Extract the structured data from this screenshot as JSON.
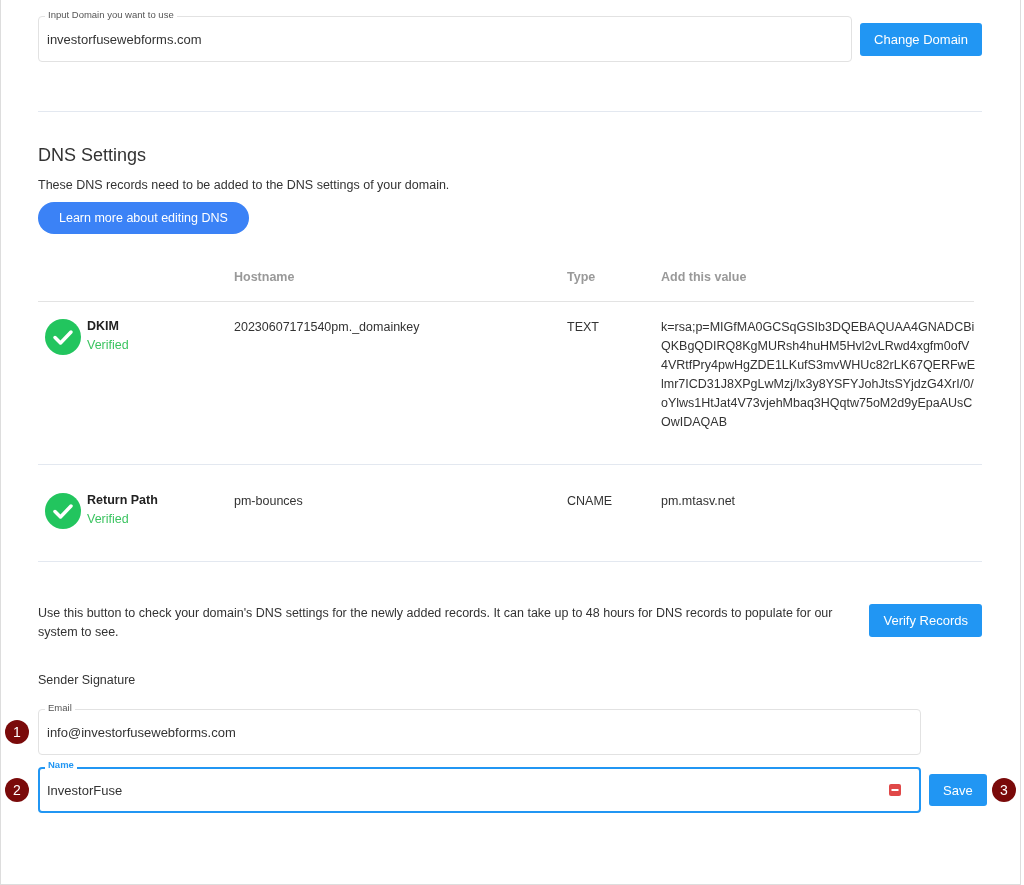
{
  "domain_field": {
    "label": "Input Domain you want to use",
    "value": "investorfusewebforms.com"
  },
  "change_domain_button": "Change Domain",
  "dns": {
    "title": "DNS Settings",
    "description": "These DNS records need to be added to the DNS settings of your domain.",
    "learn_more_button": "Learn more about editing DNS"
  },
  "table": {
    "columns": [
      "Hostname",
      "Type",
      "Add this value"
    ],
    "rows": [
      {
        "name": "DKIM",
        "status": "Verified",
        "verified": true,
        "hostname": "20230607171540pm._domainkey",
        "type": "TEXT",
        "value": "k=rsa;p=MIGfMA0GCSqGSIb3DQEBAQUAA4GNADCBiQKBgQDIRQ8KgMURsh4huHM5Hvl2vLRwd4xgfm0ofV4VRtfPry4pwHgZDE1LKufS3mvWHUc82rLK67QERFwElmr7ICD31J8XPgLwMzj/lx3y8YSFYJohJtsSYjdzG4XrI/0/oYlws1HtJat4V73vjehMbaq3HQqtw75oM2d9yEpaAUsCOwIDAQAB"
      },
      {
        "name": "Return Path",
        "status": "Verified",
        "verified": true,
        "hostname": "pm-bounces",
        "type": "CNAME",
        "value": "pm.mtasv.net"
      }
    ]
  },
  "verify": {
    "description": "Use this button to check your domain's DNS settings for the newly added records. It can take up to 48 hours for DNS records to populate for our system to see.",
    "button": "Verify Records"
  },
  "sender_signature": {
    "title": "Sender Signature",
    "fields": [
      {
        "label": "Email",
        "value": "info@investorfusewebforms.com",
        "focused": false,
        "marker": "1"
      },
      {
        "label": "Name",
        "value": "InvestorFuse",
        "focused": true,
        "marker": "2"
      }
    ],
    "save_button": "Save",
    "save_marker": "3"
  }
}
